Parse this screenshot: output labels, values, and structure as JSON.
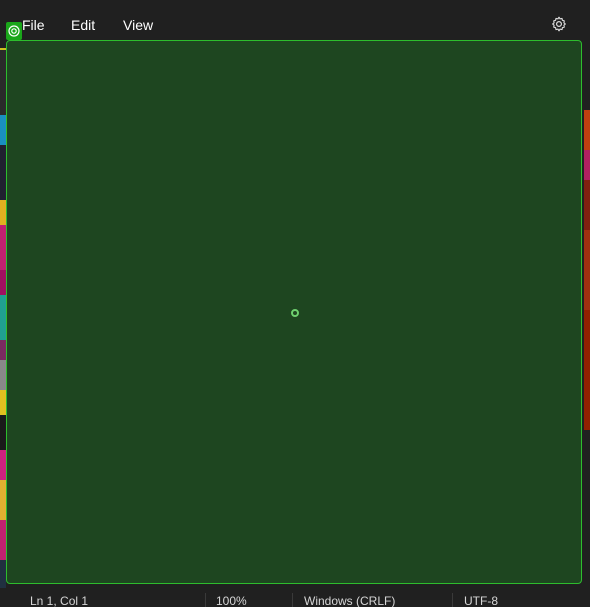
{
  "menu": {
    "file": "File",
    "edit": "Edit",
    "view": "View"
  },
  "icons": {
    "settings": "gear-icon",
    "overlay": "target-icon"
  },
  "status": {
    "position": "Ln 1, Col 1",
    "zoom": "100%",
    "line_ending": "Windows (CRLF)",
    "encoding": "UTF-8"
  },
  "colors": {
    "highlight": "#2dbd2d",
    "editor_fill": "#1e4620"
  }
}
